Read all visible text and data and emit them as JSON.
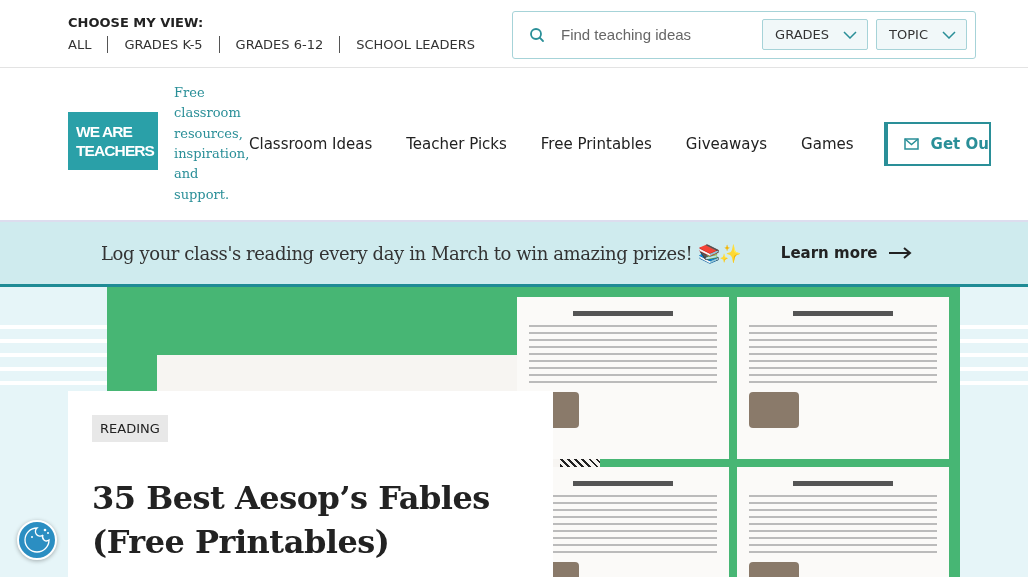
{
  "view_switcher": {
    "label": "CHOOSE MY VIEW:",
    "options": [
      {
        "label": "ALL",
        "selected": false
      },
      {
        "label": "GRADES K-5",
        "selected": false
      },
      {
        "label": "GRADES 6-12",
        "selected": false
      },
      {
        "label": "SCHOOL LEADERS",
        "selected": false
      }
    ]
  },
  "search": {
    "placeholder": "Find teaching ideas",
    "filters": [
      "GRADES",
      "TOPIC"
    ]
  },
  "logo": {
    "lines": [
      "WE ARE",
      "TEACHERS"
    ],
    "tagline": "Free classroom resources, inspiration, and support."
  },
  "nav": [
    "Classroom Ideas",
    "Teacher Picks",
    "Free Printables",
    "Giveaways",
    "Games"
  ],
  "cta": {
    "label": "Get Ou"
  },
  "banner": {
    "text": "Log your class's reading every day in March to win amazing prizes! 📚✨",
    "link": "Learn more"
  },
  "article": {
    "tag": "READING",
    "title": "35 Best Aesop’s Fables (Free Printables)"
  }
}
